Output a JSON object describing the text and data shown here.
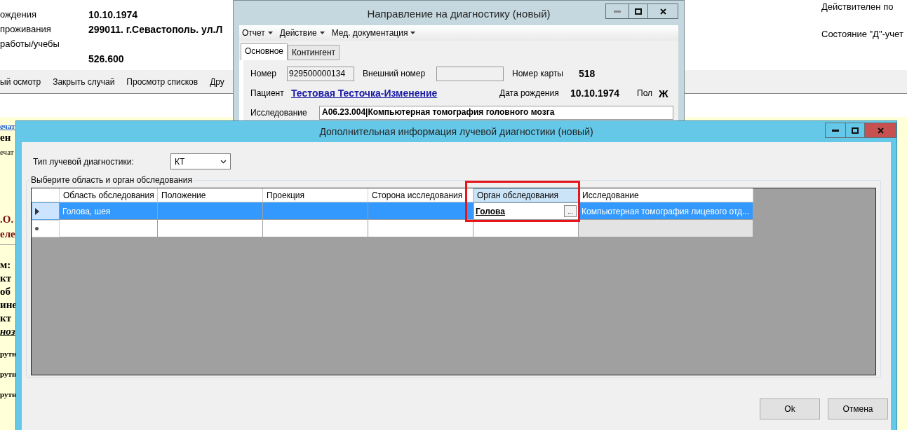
{
  "background_page": {
    "fields": [
      {
        "label": "ождения",
        "value": "10.10.1974"
      },
      {
        "label": "проживания",
        "value": "299011. г.Севастополь. ул.Л"
      },
      {
        "label": "работы/учебы"
      },
      {
        "value": "526.600"
      }
    ],
    "toolbar": [
      "ый осмотр",
      "Закрыть случай",
      "Просмотр списков",
      "Дру"
    ],
    "right_texts": [
      "Действителен по",
      "Состояние \"Д\"-учет"
    ],
    "left_fragments": [
      {
        "text": "ечат",
        "kind": "link"
      },
      {
        "text": "ен",
        "kind": "bold"
      },
      {
        "text": "ечат",
        "kind": "plain"
      },
      {
        "text": ".О.",
        "kind": "heading"
      },
      {
        "text": "еле",
        "kind": "heading"
      },
      {
        "text": "м:",
        "kind": "label"
      },
      {
        "text": "кт",
        "kind": "bold"
      },
      {
        "text": "об",
        "kind": "bold"
      },
      {
        "text": "ине",
        "kind": "bold"
      },
      {
        "text": "кт",
        "kind": "bold"
      },
      {
        "text": "ноз",
        "kind": "italic"
      },
      {
        "text": "рутн",
        "kind": "small"
      },
      {
        "text": "рутн",
        "kind": "small"
      },
      {
        "text": "рутн",
        "kind": "small"
      }
    ]
  },
  "referral_window": {
    "title": "Направление на диагностику (новый)",
    "menu": [
      "Отчет",
      "Действие",
      "Мед. документация"
    ],
    "tabs": [
      {
        "label": "Основное",
        "selected": true
      },
      {
        "label": "Контингент",
        "selected": false
      }
    ],
    "number_label": "Номер",
    "number_value": "929500000134",
    "external_label": "Внешний номер",
    "card_label": "Номер карты",
    "card_value": "518",
    "patient_label": "Пациент",
    "patient_value": "Тестовая Тесточка-Изменение",
    "birth_label": "Дата рождения",
    "birth_value": "10.10.1974",
    "sex_label": "Пол",
    "sex_value": "Ж",
    "study_label": "Исследование",
    "study_value": "A06.23.004|Компьютерная томография головного мозга"
  },
  "dialog": {
    "title": "Дополнительная информация лучевой диагностики (новый)",
    "type_label": "Тип лучевой диагностики:",
    "type_value": "КТ",
    "group_title": "Выберите область и орган обследования",
    "columns": [
      {
        "label": "Область обследования",
        "current": false,
        "highlighted": false
      },
      {
        "label": "Положение",
        "current": false,
        "highlighted": false
      },
      {
        "label": "Проекция",
        "current": false,
        "highlighted": false
      },
      {
        "label": "Сторона исследования",
        "current": false,
        "highlighted": false
      },
      {
        "label": "Орган обследования",
        "current": true,
        "highlighted": true
      },
      {
        "label": "Исследование",
        "current": false,
        "highlighted": false
      }
    ],
    "rows": [
      {
        "kind": "data",
        "selected": true,
        "cells": [
          {
            "text": "Голова, шея",
            "editing": false
          },
          {
            "text": "",
            "editing": false
          },
          {
            "text": "",
            "editing": false
          },
          {
            "text": "",
            "editing": false
          },
          {
            "text": "Голова",
            "editing": true,
            "button_text": "..."
          },
          {
            "text": "Компьютерная томография лицевого отд...",
            "editing": false
          }
        ]
      },
      {
        "kind": "new",
        "selected": false
      }
    ],
    "buttons": [
      "Ok",
      "Отмена"
    ]
  }
}
